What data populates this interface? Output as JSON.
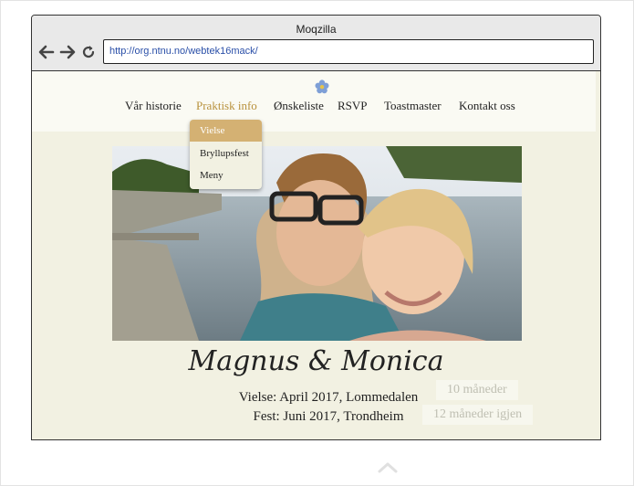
{
  "window": {
    "title": "Moqzilla"
  },
  "toolbar": {
    "back_icon": "arrow-left-icon",
    "forward_icon": "arrow-right-icon",
    "reload_icon": "reload-icon",
    "url": "http://org.ntnu.no/webtek16mack/"
  },
  "site": {
    "logo_icon": "forget-me-not-flower-icon",
    "nav": [
      {
        "label": "Vår historie"
      },
      {
        "label": "Praktisk info",
        "active": true
      },
      {
        "label": "Ønskeliste"
      },
      {
        "label": "RSVP"
      },
      {
        "label": "Toastmaster"
      },
      {
        "label": "Kontakt oss"
      }
    ],
    "dropdown": [
      {
        "label": "Vielse",
        "selected": true
      },
      {
        "label": "Bryllupsfest"
      },
      {
        "label": "Meny"
      }
    ],
    "couple": "Magnus & Monica",
    "ceremony": "Vielse: April 2017, Lommedalen",
    "party": "Fest: Juni 2017, Trondheim",
    "countdown_1": "10 måneder",
    "countdown_2": "12 måneder igjen"
  },
  "colors": {
    "accent": "#b8913c",
    "dropdown_selected": "#d4b173",
    "page_background": "#f2f1e2"
  },
  "footer": {
    "scroll_top_icon": "chevron-up-icon"
  }
}
